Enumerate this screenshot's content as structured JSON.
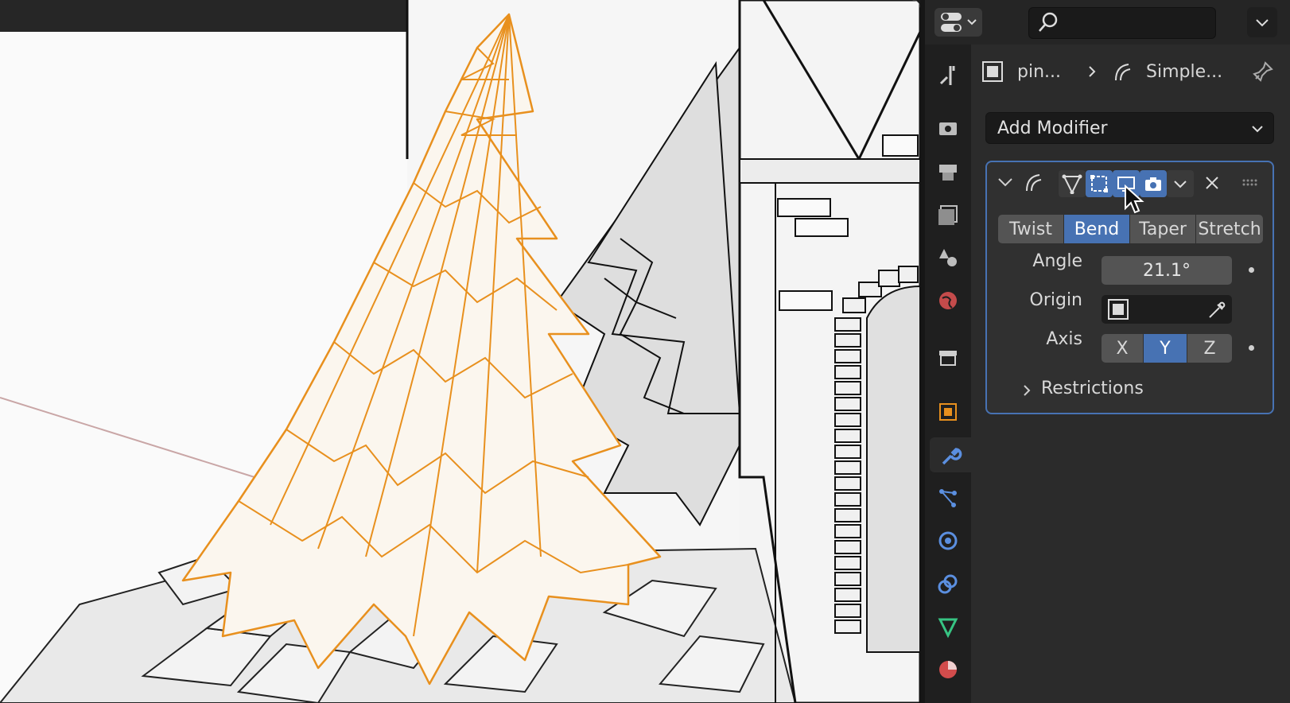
{
  "breadcrumb": {
    "object_name": "pin...",
    "modifier_name": "Simple..."
  },
  "add_modifier": {
    "label": "Add Modifier"
  },
  "modifier": {
    "modes": [
      "Twist",
      "Bend",
      "Taper",
      "Stretch"
    ],
    "active_mode": "Bend",
    "angle_label": "Angle",
    "angle_value": "21.1°",
    "origin_label": "Origin",
    "axis_label": "Axis",
    "axes": [
      "X",
      "Y",
      "Z"
    ],
    "active_axis": "Y",
    "restrictions_label": "Restrictions"
  },
  "tabs": [
    "tool-icon",
    "render-icon",
    "output-icon",
    "view-layer-icon",
    "scene-icon",
    "world-icon",
    "collection-icon",
    "object-icon",
    "modifier-icon",
    "particles-icon",
    "physics-icon",
    "constraints-icon",
    "data-icon",
    "material-icon"
  ],
  "colors": {
    "accent": "#4772b3",
    "selection": "#e8901e",
    "panel": "#2b2b2b"
  }
}
